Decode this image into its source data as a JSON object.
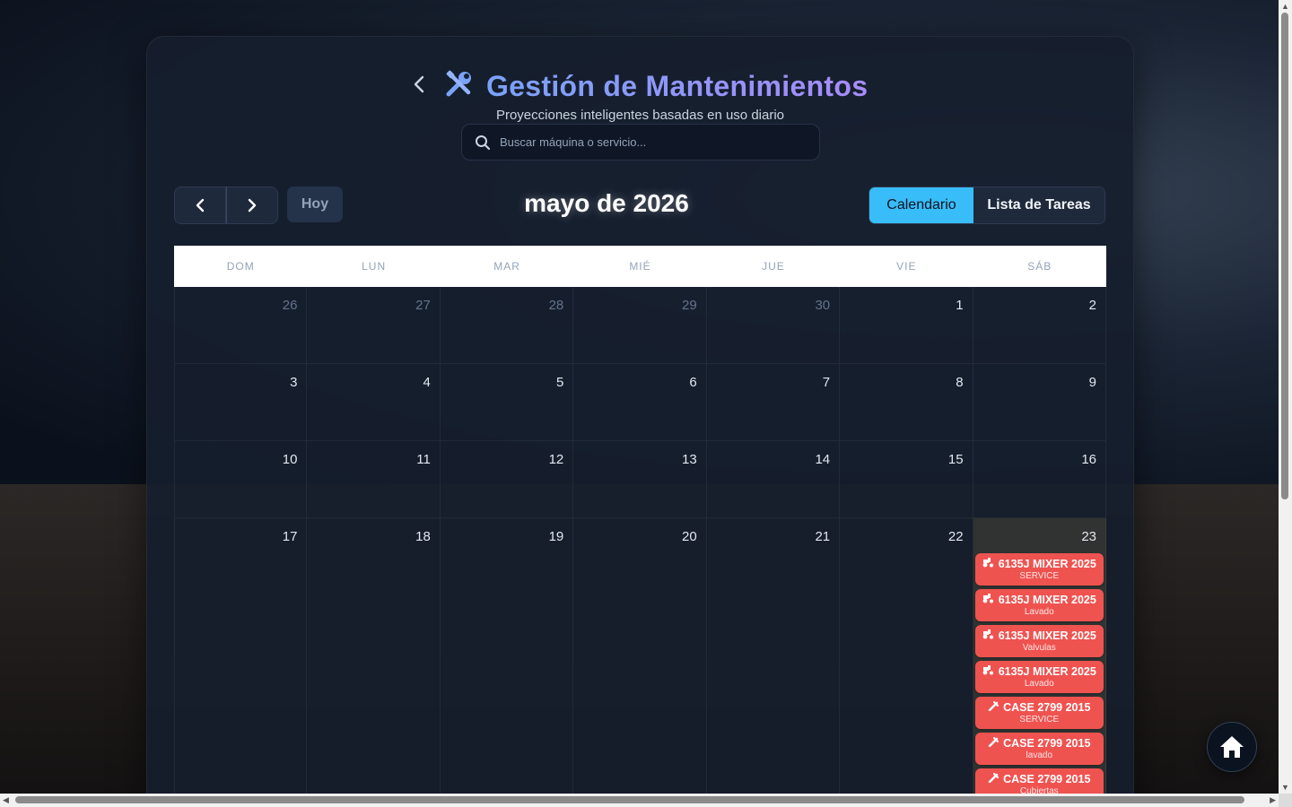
{
  "header": {
    "title": "Gestión de Mantenimientos",
    "subtitle": "Proyecciones inteligentes basadas en uso diario"
  },
  "search": {
    "placeholder": "Buscar máquina o servicio...",
    "value": ""
  },
  "toolbar": {
    "today_label": "Hoy",
    "month_title": "mayo de 2026",
    "view_calendar": "Calendario",
    "view_tasks": "Lista de Tareas"
  },
  "calendar": {
    "weekdays": [
      "DOM",
      "LUN",
      "MAR",
      "MIÉ",
      "JUE",
      "VIE",
      "SÁB"
    ],
    "weeks": [
      [
        "26",
        "27",
        "28",
        "29",
        "30",
        "1",
        "2"
      ],
      [
        "3",
        "4",
        "5",
        "6",
        "7",
        "8",
        "9"
      ],
      [
        "10",
        "11",
        "12",
        "13",
        "14",
        "15",
        "16"
      ],
      [
        "17",
        "18",
        "19",
        "20",
        "21",
        "22",
        "23"
      ]
    ],
    "events_day_23": [
      {
        "title": "6135J MIXER 2025",
        "sub": "SERVICE",
        "icon": "tractor-icon"
      },
      {
        "title": "6135J MIXER 2025",
        "sub": "Lavado",
        "icon": "tractor-icon"
      },
      {
        "title": "6135J MIXER 2025",
        "sub": "Valvulas",
        "icon": "tractor-icon"
      },
      {
        "title": "6135J MIXER 2025",
        "sub": "Lavado",
        "icon": "tractor-icon"
      },
      {
        "title": "CASE 2799 2015",
        "sub": "SERVICE",
        "icon": "harvester-icon"
      },
      {
        "title": "CASE 2799 2015",
        "sub": "lavado",
        "icon": "harvester-icon"
      },
      {
        "title": "CASE 2799 2015",
        "sub": "Cubiertas",
        "icon": "harvester-icon"
      }
    ]
  },
  "colors": {
    "accent": "#38bdf8",
    "event": "#ef5350",
    "title_gradient_start": "#7aa2f7",
    "title_gradient_end": "#a78bfa"
  }
}
